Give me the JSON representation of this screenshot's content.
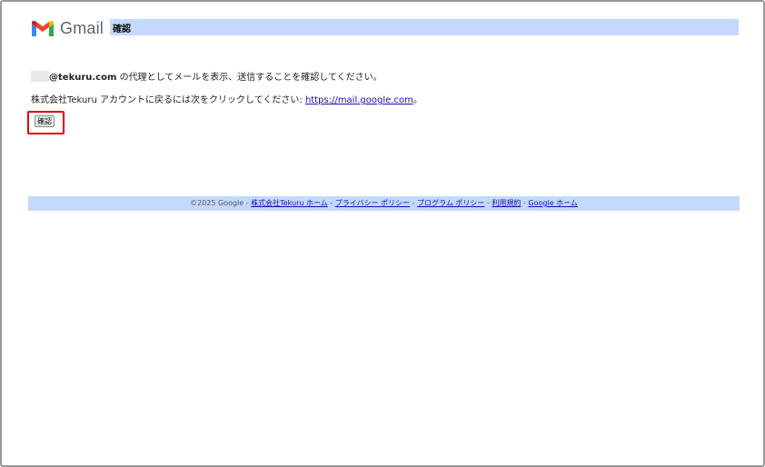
{
  "header": {
    "logo_text": "Gmail",
    "title": "確認"
  },
  "content": {
    "email_partial": "@tekuru.com",
    "line1_rest": " の代理としてメールを表示、送信することを確認してください。",
    "line2_prefix": "株式会社Tekuru アカウントに戻るには次をクリックしてください: ",
    "line2_link": "https://mail.google.com",
    "line2_suffix": "。"
  },
  "confirm_button": {
    "label": "確認"
  },
  "footer": {
    "copyright": "©2025 Google",
    "separator": " - ",
    "links": [
      "株式会社Tekuru ホーム",
      "プライバシー ポリシー",
      "プログラム ポリシー",
      "利用規約",
      "Google ホーム"
    ]
  },
  "colors": {
    "title_bar": "#c3d9ff",
    "footer_bar": "#c3d9ff",
    "link": "#1a0dab",
    "highlight_border": "#e00000"
  }
}
